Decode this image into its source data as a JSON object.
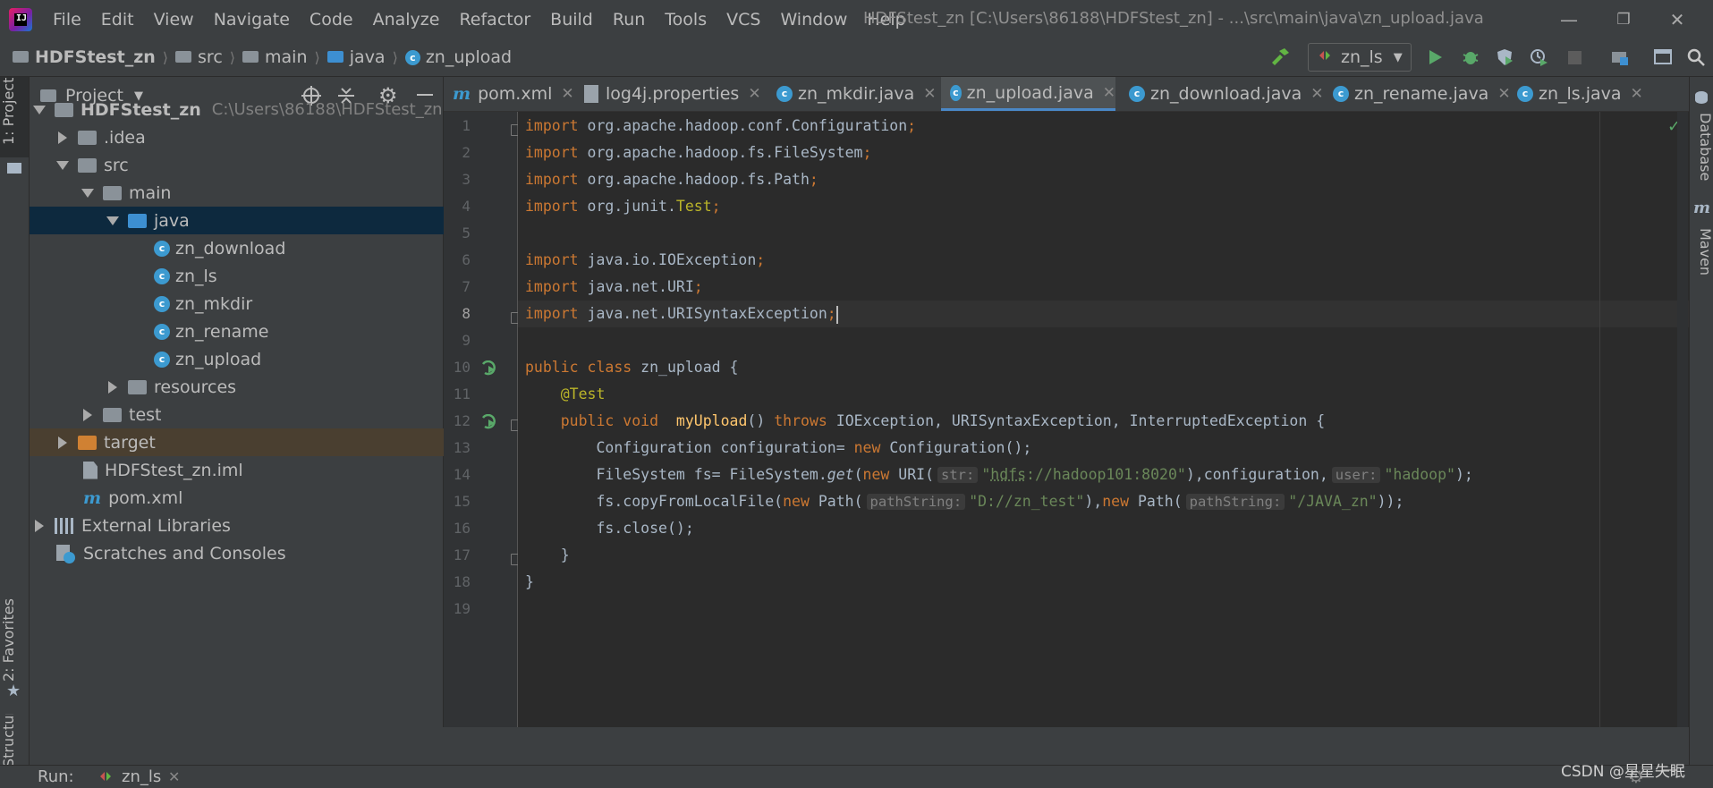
{
  "menubar": {
    "logo_text": "IJ",
    "items": [
      "File",
      "Edit",
      "View",
      "Navigate",
      "Code",
      "Analyze",
      "Refactor",
      "Build",
      "Run",
      "Tools",
      "VCS",
      "Window",
      "Help"
    ],
    "window_title": "HDFStest_zn [C:\\Users\\86188\\HDFStest_zn] - ...\\src\\main\\java\\zn_upload.java"
  },
  "navbar": {
    "crumbs": [
      "HDFStest_zn",
      "src",
      "main",
      "java",
      "zn_upload"
    ],
    "run_config": "zn_ls"
  },
  "left_strip": {
    "project_tab": "1: Project",
    "favorites_tab": "2: Favorites",
    "structure_tab": "Structure"
  },
  "right_strip": {
    "database_tab": "Database",
    "maven_tab": "Maven"
  },
  "project": {
    "title": "Project",
    "tree": [
      {
        "label": "HDFStest_zn",
        "hint": "C:\\Users\\86188\\HDFStest_zn"
      },
      {
        "label": ".idea"
      },
      {
        "label": "src"
      },
      {
        "label": "main"
      },
      {
        "label": "java"
      },
      {
        "label": "zn_download"
      },
      {
        "label": "zn_ls"
      },
      {
        "label": "zn_mkdir"
      },
      {
        "label": "zn_rename"
      },
      {
        "label": "zn_upload"
      },
      {
        "label": "resources"
      },
      {
        "label": "test"
      },
      {
        "label": "target"
      },
      {
        "label": "HDFStest_zn.iml"
      },
      {
        "label": "pom.xml"
      },
      {
        "label": "External Libraries"
      },
      {
        "label": "Scratches and Consoles"
      }
    ]
  },
  "tabs": [
    {
      "label": "pom.xml"
    },
    {
      "label": "log4j.properties"
    },
    {
      "label": "zn_mkdir.java"
    },
    {
      "label": "zn_upload.java"
    },
    {
      "label": "zn_download.java"
    },
    {
      "label": "zn_rename.java"
    },
    {
      "label": "zn_ls.java"
    }
  ],
  "active_tab": "zn_upload.java",
  "code": {
    "line_numbers": [
      "1",
      "2",
      "3",
      "4",
      "5",
      "6",
      "7",
      "8",
      "9",
      "10",
      "11",
      "12",
      "13",
      "14",
      "15",
      "16",
      "17",
      "18",
      "19"
    ],
    "l1": "org.apache.hadoop.conf.Configuration",
    "l2": "org.apache.hadoop.fs.FileSystem",
    "l3": "org.apache.hadoop.fs.Path",
    "l4a": "org.junit.",
    "l4b": "Test",
    "l6": "java.io.IOException",
    "l7": "java.net.URI",
    "l8": "java.net.URISyntaxException",
    "kw_import": "import",
    "kw_public": "public",
    "kw_class": "class",
    "kw_void": "void",
    "kw_throws": "throws",
    "kw_new": "new",
    "class_name": "zn_upload",
    "annotation": "@Test",
    "method_name": "myUpload",
    "exceptions": "IOException, URISyntaxException, InterruptedException",
    "l13a": "Configuration configuration= ",
    "l13b": "Configuration();",
    "l14a": "FileSystem fs= FileSystem.",
    "l14get": "get",
    "l14b": "URI(",
    "hint_str": "str:",
    "l14str1": "\"",
    "l14str_hdfs": "hdfs",
    "l14str2": "://hadoop101:8020\"",
    "l14c": "),configuration,",
    "hint_user": "user:",
    "l14str3": "\"hadoop\"",
    "l14d": ");",
    "l15a": "fs.copyFromLocalFile(",
    "l15b": "Path(",
    "hint_path": "pathString:",
    "l15str1": "\"D://zn_test\"",
    "l15c": "),",
    "l15str2": "\"/JAVA_zn\"",
    "l15d": "));",
    "l16": "fs.close();",
    "brace_open": "{",
    "brace_close": "}",
    "paren_sig": "()"
  },
  "bottom": {
    "run_label": "Run:",
    "run_tab": "zn_ls"
  },
  "watermark": "CSDN @星星失眠",
  "colors": {
    "keyword": "#cc7832",
    "string": "#6a8759",
    "annotation": "#bbb529",
    "method": "#ffc66d",
    "selection": "#0d293e",
    "accent": "#4a88c7"
  }
}
